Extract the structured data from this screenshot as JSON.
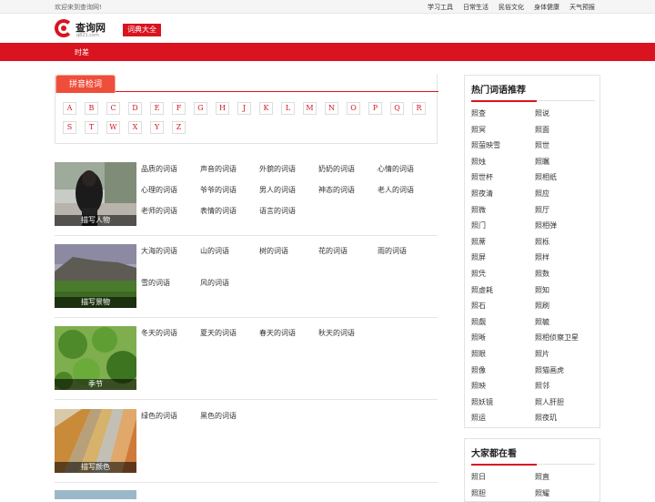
{
  "topbar": {
    "welcome": "欢迎来到查询网!",
    "nav": [
      "学习工具",
      "日常生活",
      "民俗文化",
      "身体健康",
      "天气预报"
    ]
  },
  "logo": {
    "name": "查询网",
    "domain": "q821.com"
  },
  "header": {
    "dict_button": "词典大全"
  },
  "breadcrumb": "时差",
  "pinyin": {
    "tab_label": "拼音检词",
    "letters": [
      "A",
      "B",
      "C",
      "D",
      "E",
      "F",
      "G",
      "H",
      "J",
      "K",
      "L",
      "M",
      "N",
      "O",
      "P",
      "Q",
      "R",
      "S",
      "T",
      "W",
      "X",
      "Y",
      "Z"
    ]
  },
  "categories": [
    {
      "caption": "描写人物",
      "links": [
        "品质的词语",
        "声音的词语",
        "外貌的词语",
        "奶奶的词语",
        "心情的词语",
        "心理的词语",
        "爷爷的词语",
        "男人的词语",
        "神态的词语",
        "老人的词语",
        "老师的词语",
        "表情的词语",
        "语言的词语"
      ]
    },
    {
      "caption": "描写景物",
      "links": [
        "大海的词语",
        "山的词语",
        "树的词语",
        "花的词语",
        "雨的词语",
        "雪的词语",
        "风的词语"
      ]
    },
    {
      "caption": "季节",
      "links": [
        "冬天的词语",
        "夏天的词语",
        "春天的词语",
        "秋天的词语"
      ]
    },
    {
      "caption": "描写颜色",
      "links": [
        "绿色的词语",
        "黑色的词语"
      ]
    }
  ],
  "sidebar": {
    "hot": {
      "title": "热门词语推荐",
      "words": [
        "照查",
        "照说",
        "照冥",
        "照面",
        "照萤映雪",
        "照世",
        "照烛",
        "照瞩",
        "照世杯",
        "照相纸",
        "照夜清",
        "照应",
        "照微",
        "照厅",
        "照门",
        "照相弹",
        "照蓆",
        "照栎",
        "照屏",
        "照样",
        "照凭",
        "照数",
        "照虚耗",
        "照知",
        "照石",
        "照刷",
        "照觑",
        "照毓",
        "照晰",
        "照相侦察卫星",
        "照眼",
        "照片",
        "照像",
        "照猫画虎",
        "照映",
        "照邻",
        "照妖镜",
        "照人肝胆",
        "照运",
        "照夜玑"
      ]
    },
    "popular": {
      "title": "大家都在看",
      "words": [
        "照日",
        "照直",
        "照胆",
        "照耀"
      ]
    }
  }
}
